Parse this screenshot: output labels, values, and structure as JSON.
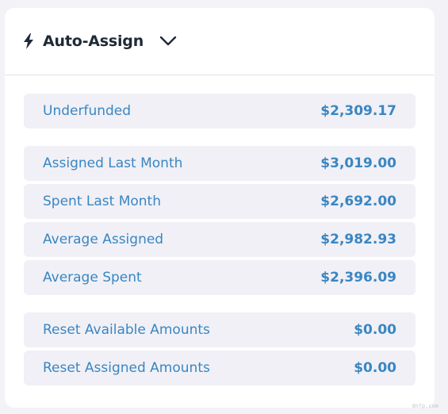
{
  "header": {
    "title": "Auto-Assign",
    "icon": "lightning-bolt-icon",
    "toggle_icon": "chevron-down-icon"
  },
  "rows": [
    {
      "label": "Underfunded",
      "value": "$2,309.17"
    },
    {
      "label": "Assigned Last Month",
      "value": "$3,019.00"
    },
    {
      "label": "Spent Last Month",
      "value": "$2,692.00"
    },
    {
      "label": "Average Assigned",
      "value": "$2,982.93"
    },
    {
      "label": "Average Spent",
      "value": "$2,396.09"
    },
    {
      "label": "Reset Available Amounts",
      "value": "$0.00"
    },
    {
      "label": "Reset Assigned Amounts",
      "value": "$0.00"
    }
  ],
  "watermark": "dnfp.com",
  "colors": {
    "accent": "#3a86c2",
    "row_bg": "#f0f0f6",
    "title": "#1f2a37"
  }
}
